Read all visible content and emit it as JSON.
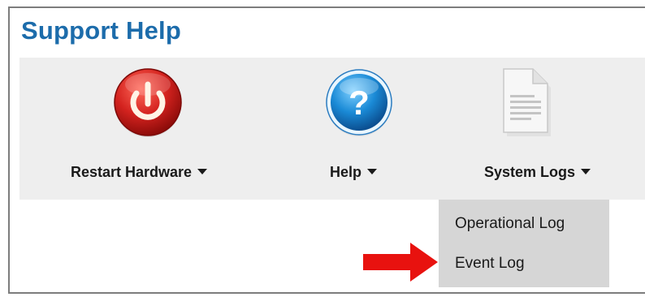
{
  "panel": {
    "title": "Support Help"
  },
  "toolbar": {
    "items": [
      {
        "label": "Restart Hardware",
        "icon": "power-icon"
      },
      {
        "label": "Help",
        "icon": "question-icon"
      },
      {
        "label": "System Logs",
        "icon": "document-icon"
      }
    ]
  },
  "dropdown": {
    "items": [
      {
        "label": "Operational Log"
      },
      {
        "label": "Event Log"
      }
    ]
  },
  "colors": {
    "title": "#1c6cab",
    "toolbar_bg": "#eeeeee",
    "dropdown_bg": "#d6d6d6",
    "power_red": "#d4231f",
    "help_blue": "#1a8ad6",
    "arrow_red": "#e8120f"
  }
}
